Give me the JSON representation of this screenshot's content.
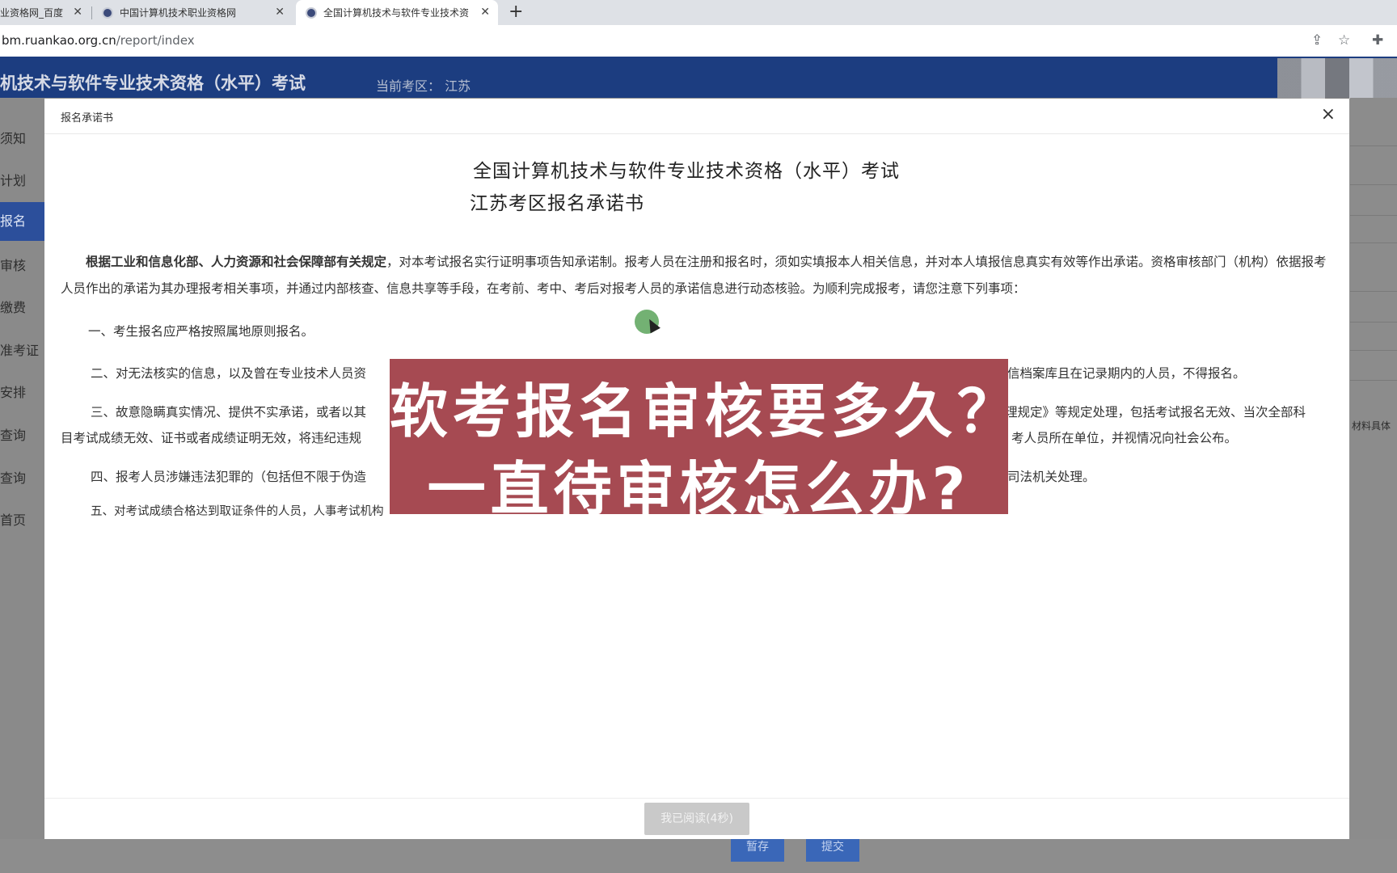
{
  "browser": {
    "tabs": [
      {
        "title": "业资格网_百度"
      },
      {
        "title": "中国计算机技术职业资格网"
      },
      {
        "title": "全国计算机技术与软件专业技术资"
      }
    ],
    "url_host": "bm.ruankao.org.cn",
    "url_path": "/report/index"
  },
  "site": {
    "title": "机技术与软件专业技术资格（水平）考试",
    "region": "当前考区： 江苏",
    "sidebar": [
      "须知",
      "计划",
      "报名",
      "审核",
      "缴费",
      "准考证",
      "安排",
      "查询",
      "查询",
      "首页"
    ],
    "right_note": "材料具体",
    "bottom_buttons": {
      "save": "暂存",
      "submit": "提交"
    }
  },
  "modal": {
    "header_title": "报名承诺书",
    "doc_title": "全国计算机技术与软件专业技术资格（水平）考试",
    "doc_subtitle": "江苏考区报名承诺书",
    "intro_bold": "根据工业和信息化部、人力资源和社会保障部有关规定",
    "intro_rest": "，对本考试报名实行证明事项告知承诺制。报考人员在注册和报名时，须如实填报本人相关信息，并对本人填报信息真实有效等作出承诺。资格审核部门（机构）依据报考人员作出的承诺为其办理报考相关事项，并通过内部核查、信息共享等手段，在考前、考中、考后对报考人员的承诺信息进行动态核验。为顺利完成报考，请您注意下列事项：",
    "item1": "一、考生报名应严格按照属地原则报名。",
    "item2_a": "二、对无法核实的信息，以及曾在专业技术人员资",
    "item2_b": "信档案库且在记录期内的人员，不得报名。",
    "item3_a": "三、故意隐瞒真实情况、提供不实承诺，或者以其",
    "item3_b": "理规定》等规定处理，包括考试报名无效、当次全部科",
    "item3_c": "目考试成绩无效、证书或者成绩证明无效，将违纪违规",
    "item3_d": "考人员所在单位，并视情况向社会公布。",
    "item4_a": "四、报考人员涉嫌违法犯罪的（包括但不限于伪造",
    "item4_b": "司法机关处理。",
    "item5_a": "五、对考试成绩合格达到取证条件的人员，人事考试机构",
    "read_button": "我已阅读(4秒)"
  },
  "banner": {
    "line1": "软考报名审核要多久？",
    "line2": "一直待审核怎么办?"
  }
}
